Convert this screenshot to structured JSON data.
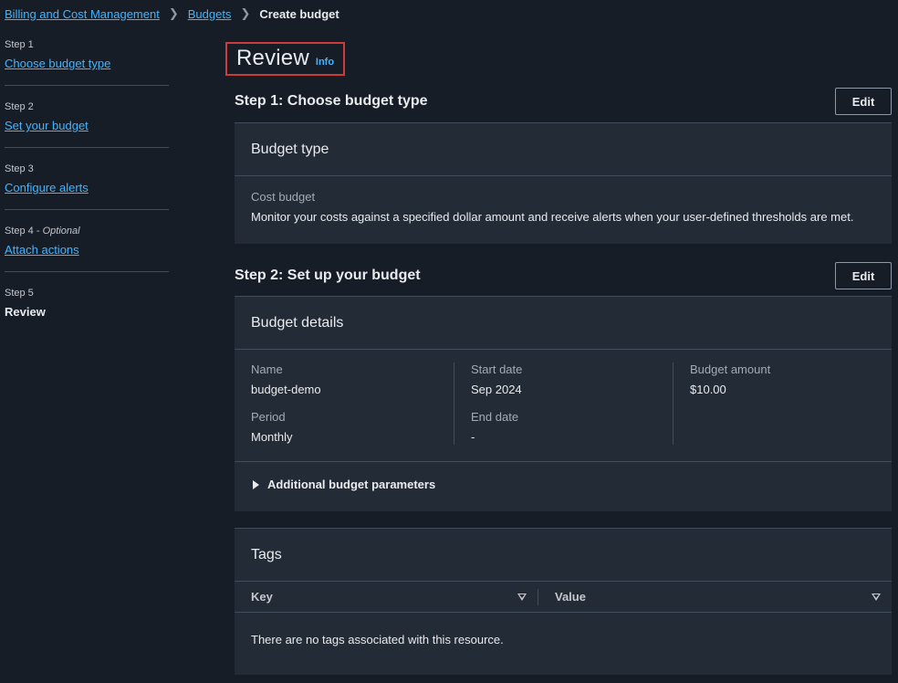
{
  "breadcrumb": {
    "items": [
      "Billing and Cost Management",
      "Budgets"
    ],
    "current": "Create budget"
  },
  "sidenav": {
    "steps": [
      {
        "num": "Step 1",
        "label": "Choose budget type"
      },
      {
        "num": "Step 2",
        "label": "Set your budget"
      },
      {
        "num": "Step 3",
        "label": "Configure alerts"
      },
      {
        "num": "Step 4",
        "optional": "Optional",
        "label": "Attach actions"
      },
      {
        "num": "Step 5",
        "label": "Review"
      }
    ]
  },
  "page": {
    "title": "Review",
    "info": "Info"
  },
  "section1": {
    "title": "Step 1: Choose budget type",
    "edit": "Edit",
    "card_title": "Budget type",
    "key": "Cost budget",
    "value": "Monitor your costs against a specified dollar amount and receive alerts when your user-defined thresholds are met."
  },
  "section2": {
    "title": "Step 2: Set up your budget",
    "edit": "Edit",
    "card_title": "Budget details",
    "name_key": "Name",
    "name_val": "budget-demo",
    "period_key": "Period",
    "period_val": "Monthly",
    "start_key": "Start date",
    "start_val": "Sep 2024",
    "end_key": "End date",
    "end_val": "-",
    "amount_key": "Budget amount",
    "amount_val": "$10.00",
    "expand": "Additional budget parameters"
  },
  "tags": {
    "title": "Tags",
    "col_key": "Key",
    "col_value": "Value",
    "empty": "There are no tags associated with this resource."
  }
}
